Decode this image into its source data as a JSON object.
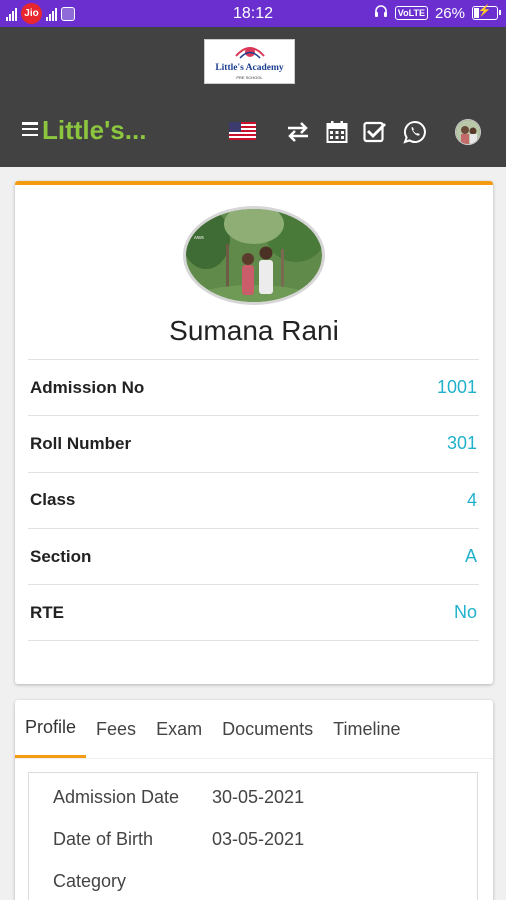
{
  "status_bar": {
    "carrier": "Jio",
    "time": "18:12",
    "network_badge": "VoLTE",
    "battery": "26%",
    "battery_fraction": 0.26
  },
  "header": {
    "app_title": "Little's...",
    "logo_text": "Little's Academy",
    "logo_subtext": "PRE SCHOOL",
    "icons": [
      "menu-icon",
      "us-flag-icon",
      "switch-icon",
      "calendar-icon",
      "checkbox-icon",
      "whatsapp-icon",
      "user-avatar"
    ],
    "brand_color": "#8cc63f",
    "header_color": "#424242",
    "status_bar_color": "#6b2fcf"
  },
  "profile": {
    "name": "Sumana Rani",
    "fields": [
      {
        "label": "Admission No",
        "value": "1001"
      },
      {
        "label": "Roll Number",
        "value": "301"
      },
      {
        "label": "Class",
        "value": "4"
      },
      {
        "label": "Section",
        "value": "A"
      },
      {
        "label": "RTE",
        "value": "No"
      }
    ],
    "accent_color": "#f39c12",
    "value_color": "#21b1cc"
  },
  "tabs": {
    "items": [
      "Profile",
      "Fees",
      "Exam",
      "Documents",
      "Timeline"
    ],
    "active": "Profile"
  },
  "details": [
    {
      "label": "Admission Date",
      "value": "30-05-2021"
    },
    {
      "label": "Date of Birth",
      "value": "03-05-2021"
    },
    {
      "label": "Category",
      "value": ""
    }
  ]
}
